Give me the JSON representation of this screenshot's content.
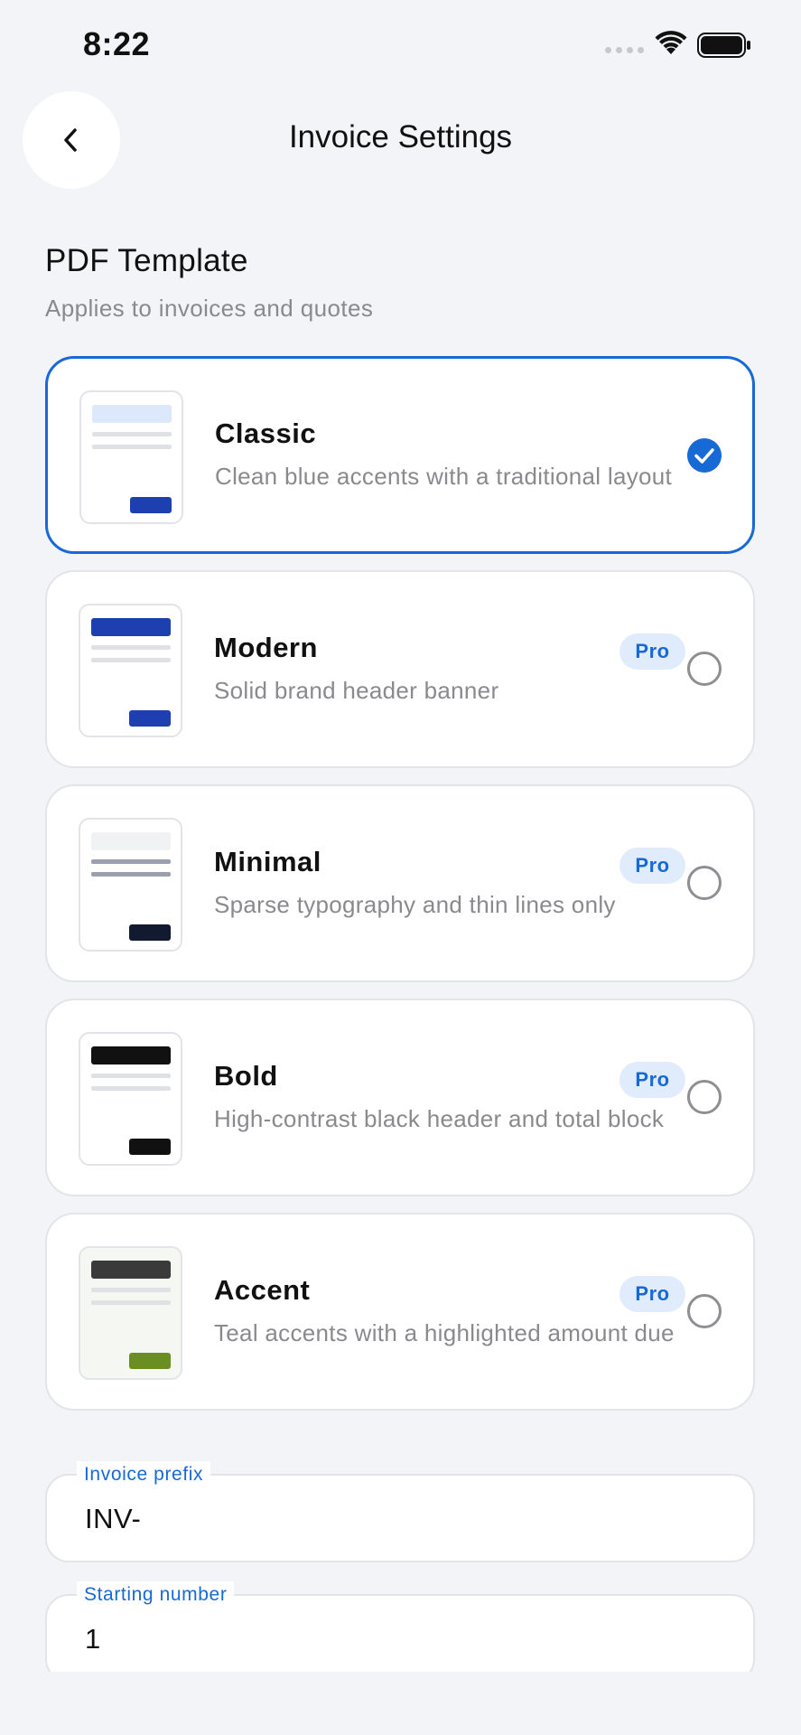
{
  "status_bar": {
    "time": "8:22"
  },
  "header": {
    "title": "Invoice Settings",
    "back_icon": "chevron-left-icon"
  },
  "section": {
    "title": "PDF Template",
    "subtitle": "Applies to invoices and quotes"
  },
  "templates": [
    {
      "name": "Classic",
      "description": "Clean blue accents with a traditional layout",
      "pro": "",
      "selected": true,
      "thumb": {
        "header": "#dce8fb",
        "total": "#1e3fb0",
        "bg": "#ffffff",
        "lines": "#dfe1e5"
      }
    },
    {
      "name": "Modern",
      "description": "Solid brand header banner",
      "pro": "Pro",
      "selected": false,
      "thumb": {
        "header": "#1e3fb0",
        "total": "#1e3fb0",
        "bg": "#ffffff",
        "lines": "#dfe1e5"
      }
    },
    {
      "name": "Minimal",
      "description": "Sparse typography and thin lines only",
      "pro": "Pro",
      "selected": false,
      "thumb": {
        "header": "#f1f2f4",
        "total": "#121a30",
        "bg": "#ffffff",
        "lines": "#9aa0ad"
      }
    },
    {
      "name": "Bold",
      "description": "High-contrast black header and total block",
      "pro": "Pro",
      "selected": false,
      "thumb": {
        "header": "#111111",
        "total": "#111111",
        "bg": "#ffffff",
        "lines": "#dfe1e5"
      }
    },
    {
      "name": "Accent",
      "description": "Teal accents with a highlighted amount due",
      "pro": "Pro",
      "selected": false,
      "thumb": {
        "header": "#3a3a3a",
        "total": "#6b8e23",
        "bg": "#f5f7f2",
        "lines": "#dfe1e5"
      }
    }
  ],
  "fields": {
    "prefix": {
      "label": "Invoice prefix",
      "value": "INV-"
    },
    "starting_number": {
      "label": "Starting number",
      "value": "1"
    }
  },
  "colors": {
    "accent": "#1769d6",
    "background": "#f3f4f7",
    "card": "#ffffff",
    "muted_text": "#8a8a8e"
  }
}
